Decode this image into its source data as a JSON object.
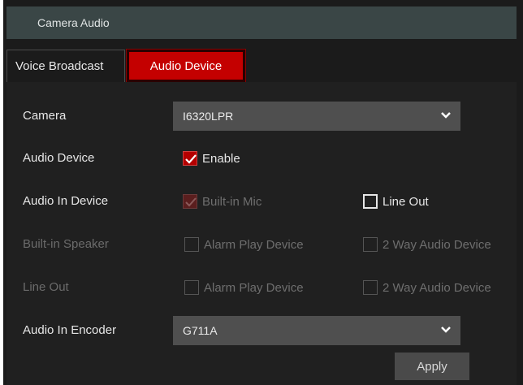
{
  "window": {
    "title": "Camera Audio"
  },
  "tabs": [
    {
      "label": "Voice Broadcast",
      "active": false
    },
    {
      "label": "Audio Device",
      "active": true
    }
  ],
  "form": {
    "camera": {
      "label": "Camera",
      "value": "I6320LPR"
    },
    "audio_device": {
      "label": "Audio Device",
      "enable_label": "Enable",
      "enabled": true
    },
    "audio_in_device": {
      "label": "Audio In Device",
      "builtin_mic": {
        "label": "Built-in Mic",
        "checked": true,
        "disabled": true
      },
      "line_out": {
        "label": "Line Out",
        "checked": false
      }
    },
    "builtin_speaker": {
      "label": "Built-in Speaker",
      "alarm_play": {
        "label": "Alarm Play Device",
        "checked": false,
        "disabled": true
      },
      "two_way": {
        "label": "2 Way Audio Device",
        "checked": false,
        "disabled": true
      }
    },
    "line_out_row": {
      "label": "Line Out",
      "alarm_play": {
        "label": "Alarm Play Device",
        "checked": false,
        "disabled": true
      },
      "two_way": {
        "label": "2 Way Audio Device",
        "checked": false,
        "disabled": true
      }
    },
    "audio_in_encoder": {
      "label": "Audio In Encoder",
      "value": "G711A"
    }
  },
  "apply_label": "Apply",
  "colors": {
    "accent": "#c40000",
    "panel": "#202020",
    "title_bar": "#3a4646"
  }
}
